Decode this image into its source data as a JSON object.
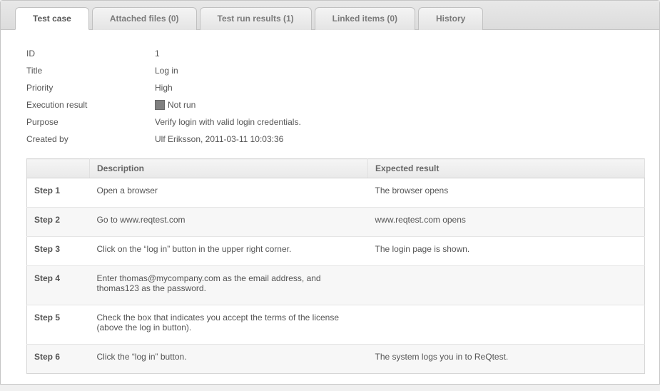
{
  "tabs": [
    {
      "label": "Test case",
      "active": true
    },
    {
      "label": "Attached files (0)",
      "active": false
    },
    {
      "label": "Test run results (1)",
      "active": false
    },
    {
      "label": "Linked items (0)",
      "active": false
    },
    {
      "label": "History",
      "active": false
    }
  ],
  "fields": {
    "id_label": "ID",
    "id_value": "1",
    "title_label": "Title",
    "title_value": "Log in",
    "priority_label": "Priority",
    "priority_value": "High",
    "execution_label": "Execution result",
    "execution_value": "Not run",
    "purpose_label": "Purpose",
    "purpose_value": "Verify login with valid login credentials.",
    "created_label": "Created by",
    "created_value": "Ulf Eriksson, 2011-03-11 10:03:36"
  },
  "table": {
    "col_step": "",
    "col_desc": "Description",
    "col_expected": "Expected result",
    "rows": [
      {
        "step": "Step 1",
        "desc": "Open a browser",
        "expected": "The browser opens"
      },
      {
        "step": "Step 2",
        "desc": "Go to www.reqtest.com",
        "expected": "www.reqtest.com opens"
      },
      {
        "step": "Step 3",
        "desc": "Click on the “log in” button in the upper right corner.",
        "expected": "The login page is shown."
      },
      {
        "step": "Step 4",
        "desc": "Enter thomas@mycompany.com as the email address, and thomas123 as the password.",
        "expected": ""
      },
      {
        "step": "Step 5",
        "desc": "Check the box that indicates you accept the terms of the license (above the log in button).",
        "expected": ""
      },
      {
        "step": "Step 6",
        "desc": "Click the “log in” button.",
        "expected": "The system logs you in to ReQtest."
      }
    ]
  }
}
